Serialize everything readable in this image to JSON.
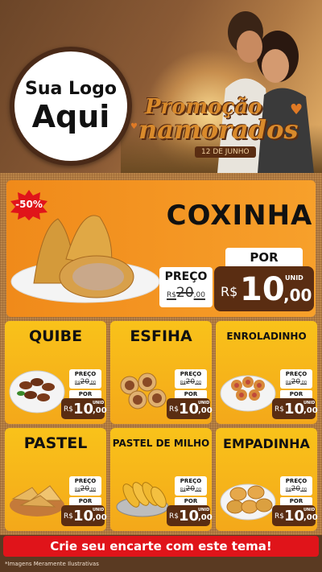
{
  "logo": {
    "line1": "Sua Logo",
    "line2": "Aqui"
  },
  "promo": {
    "line1": "Promoção",
    "line2": "namorados",
    "date": "12 DE JUNHO"
  },
  "featured": {
    "discount": "-50%",
    "name": "COXINHA",
    "price_label": "PREÇO",
    "old_currency": "R$",
    "old_int": "20",
    "old_cents": ",00",
    "por_label": "POR",
    "currency": "R$",
    "price_int": "10",
    "price_cents": ",00",
    "unit": "UNID"
  },
  "products": [
    {
      "name": "QUIBE",
      "price_label": "PREÇO",
      "old_currency": "R$",
      "old_int": "20",
      "old_cents": ",00",
      "por_label": "POR",
      "currency": "R$",
      "price_int": "10",
      "price_cents": ",00",
      "unit": "UNID"
    },
    {
      "name": "ESFIHA",
      "price_label": "PREÇO",
      "old_currency": "R$",
      "old_int": "20",
      "old_cents": ",00",
      "por_label": "POR",
      "currency": "R$",
      "price_int": "10",
      "price_cents": ",00",
      "unit": "UNID"
    },
    {
      "name": "ENROLADINHO",
      "price_label": "PREÇO",
      "old_currency": "R$",
      "old_int": "20",
      "old_cents": ",00",
      "por_label": "POR",
      "currency": "R$",
      "price_int": "10",
      "price_cents": ",00",
      "unit": "UNID"
    },
    {
      "name": "PASTEL",
      "price_label": "PREÇO",
      "old_currency": "R$",
      "old_int": "20",
      "old_cents": ",00",
      "por_label": "POR",
      "currency": "R$",
      "price_int": "10",
      "price_cents": ",00",
      "unit": "UNID"
    },
    {
      "name": "PASTEL DE MILHO",
      "price_label": "PREÇO",
      "old_currency": "R$",
      "old_int": "20",
      "old_cents": ",00",
      "por_label": "POR",
      "currency": "R$",
      "price_int": "10",
      "price_cents": ",00",
      "unit": "UNID"
    },
    {
      "name": "EMPADINHA",
      "price_label": "PREÇO",
      "old_currency": "R$",
      "old_int": "20",
      "old_cents": ",00",
      "por_label": "POR",
      "currency": "R$",
      "price_int": "10",
      "price_cents": ",00",
      "unit": "UNID"
    }
  ],
  "cta": "Crie seu encarte com este tema!",
  "disclaimer": "*Imagens Meramente Ilustrativas",
  "colors": {
    "orange": "#f08a1a",
    "yellow": "#f9c21a",
    "brown": "#5a2d12",
    "red": "#e0141a"
  }
}
